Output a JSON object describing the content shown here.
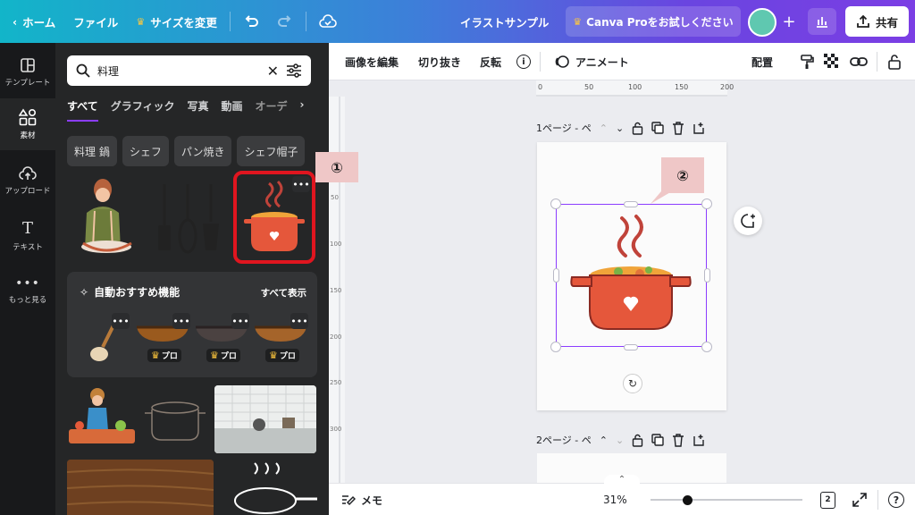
{
  "topbar": {
    "home": "ホーム",
    "file": "ファイル",
    "resize": "サイズを変更",
    "design_title": "イラストサンプル",
    "pro_trial": "Canva Proをお試しください",
    "share": "共有"
  },
  "rail": {
    "items": [
      "テンプレート",
      "素材",
      "アップロード",
      "テキスト",
      "もっと見る"
    ]
  },
  "panel": {
    "search_value": "料理",
    "tabs": [
      "すべて",
      "グラフィック",
      "写真",
      "動画",
      "オーデ"
    ],
    "chips": [
      "料理 鍋",
      "シェフ",
      "パン焼き",
      "シェフ帽子"
    ],
    "recommend_title": "自動おすすめ機能",
    "recommend_all": "すべて表示",
    "pro_label": "プロ"
  },
  "editor": {
    "edit_image": "画像を編集",
    "crop": "切り抜き",
    "flip": "反転",
    "animate": "アニメート",
    "position": "配置",
    "ruler": [
      "0",
      "50",
      "100",
      "150",
      "200"
    ],
    "ruler_left": [
      "50",
      "100",
      "150",
      "200",
      "250",
      "300"
    ],
    "page1": "1ページ - ペ",
    "page2": "2ページ - ペ"
  },
  "callouts": {
    "one": "①",
    "two": "②"
  },
  "bottom": {
    "notes": "メモ",
    "zoom": "31%",
    "page_count": "2",
    "zoom_level": 0.31
  },
  "colors": {
    "accent": "#8b3dff",
    "highlight": "#e0151f",
    "pot": "#e5573b"
  }
}
